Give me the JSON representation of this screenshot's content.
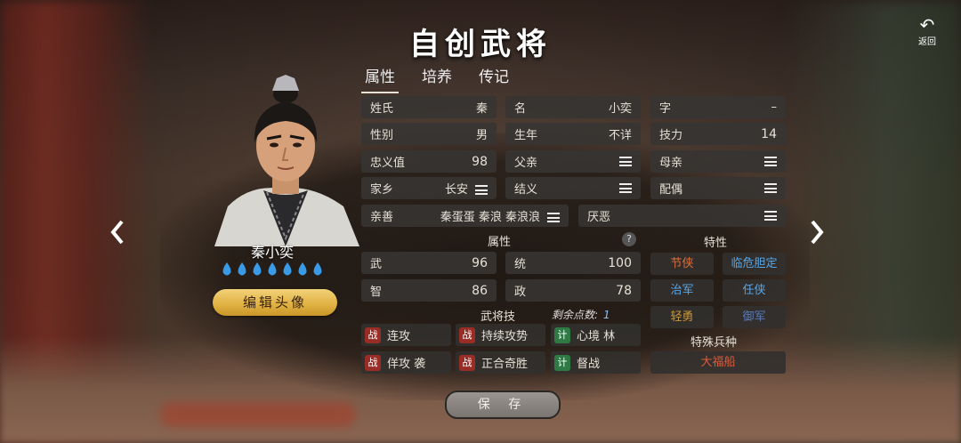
{
  "title": "自创武将",
  "back": {
    "label": "返回"
  },
  "tabs": [
    {
      "label": "属性",
      "active": true
    },
    {
      "label": "培养",
      "active": false
    },
    {
      "label": "传记",
      "active": false
    }
  ],
  "character": {
    "name": "秦小奕",
    "rank_drops": 7,
    "edit_button": "编辑头像"
  },
  "info": {
    "surname": {
      "key": "姓氏",
      "value": "秦"
    },
    "given_name": {
      "key": "名",
      "value": "小奕"
    },
    "courtesy": {
      "key": "字",
      "value": "–"
    },
    "gender": {
      "key": "性别",
      "value": "男"
    },
    "birth_year": {
      "key": "生年",
      "value": "不详"
    },
    "skill_power": {
      "key": "技力",
      "value": "14"
    },
    "loyalty": {
      "key": "忠义值",
      "value": "98"
    },
    "father": {
      "key": "父亲"
    },
    "mother": {
      "key": "母亲"
    },
    "hometown": {
      "key": "家乡",
      "value": "长安"
    },
    "sworn": {
      "key": "结义"
    },
    "spouse": {
      "key": "配偶"
    },
    "friends": {
      "key": "亲善",
      "value": "秦蛋蛋 秦浪 秦浪浪"
    },
    "dislikes": {
      "key": "厌恶"
    }
  },
  "attributes": {
    "label": "属性",
    "help": "?",
    "war": {
      "key": "武",
      "value": "96"
    },
    "command": {
      "key": "统",
      "value": "100"
    },
    "intellect": {
      "key": "智",
      "value": "86"
    },
    "politics": {
      "key": "政",
      "value": "78"
    }
  },
  "traits": {
    "label": "特性",
    "items": [
      {
        "label": "节侠",
        "color": "#e0703a"
      },
      {
        "label": "临危胆定",
        "color": "#5aa6e6"
      },
      {
        "label": "治军",
        "color": "#5aa6e6"
      },
      {
        "label": "任侠",
        "color": "#5aa6e6"
      },
      {
        "label": "轻勇",
        "color": "#c9963a"
      },
      {
        "label": "御军",
        "color": "#5a7ab8"
      }
    ]
  },
  "skills": {
    "label": "武将技",
    "remaining_label": "剩余点数:",
    "remaining_value": "1",
    "items": [
      {
        "type": "战",
        "label": "连攻"
      },
      {
        "type": "战",
        "label": "持续攻势"
      },
      {
        "type": "计",
        "label": "心境 林"
      },
      {
        "type": "战",
        "label": "佯攻 袭"
      },
      {
        "type": "战",
        "label": "正合奇胜"
      },
      {
        "type": "计",
        "label": "督战"
      }
    ]
  },
  "special_troop": {
    "label": "特殊兵种",
    "value": "大福船"
  },
  "save_button": "保 存"
}
